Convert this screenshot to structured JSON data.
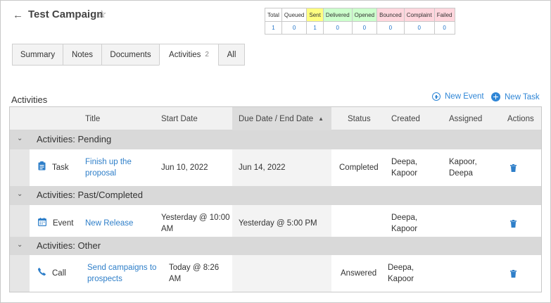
{
  "header": {
    "back_icon": "arrow-left-icon",
    "title": "Test Campaign",
    "star_icon": "star-outline-icon"
  },
  "stats": {
    "columns": [
      {
        "label": "Total",
        "value": "1",
        "color": "#ffffff"
      },
      {
        "label": "Queued",
        "value": "0",
        "color": "#ffffff"
      },
      {
        "label": "Sent",
        "value": "1",
        "color": "#ffff80"
      },
      {
        "label": "Delivered",
        "value": "0",
        "color": "#ccffcc"
      },
      {
        "label": "Opened",
        "value": "0",
        "color": "#ccffcc"
      },
      {
        "label": "Bounced",
        "value": "0",
        "color": "#ffd6dd"
      },
      {
        "label": "Complaint",
        "value": "0",
        "color": "#ffd6dd"
      },
      {
        "label": "Failed",
        "value": "0",
        "color": "#ffd6dd"
      }
    ]
  },
  "tabs": [
    {
      "label": "Summary",
      "count": ""
    },
    {
      "label": "Notes",
      "count": ""
    },
    {
      "label": "Documents",
      "count": ""
    },
    {
      "label": "Activities",
      "count": "2"
    },
    {
      "label": "All",
      "count": ""
    }
  ],
  "activities": {
    "title": "Activities",
    "new_event_label": "New Event",
    "new_task_label": "New Task",
    "columns": {
      "title": "Title",
      "start_date": "Start Date",
      "due_date": "Due Date / End Date",
      "status": "Status",
      "created": "Created",
      "assigned": "Assigned",
      "actions": "Actions"
    },
    "groups": [
      {
        "label": "Activities: Pending",
        "row": {
          "type_icon": "clipboard-icon",
          "type": "Task",
          "title_line1": "Finish up the",
          "title_line2": "proposal",
          "start_line1": "Jun 10, 2022",
          "start_line2": "",
          "due": "Jun 14, 2022",
          "status": "Completed",
          "created_line1": "Deepa,",
          "created_line2": "Kapoor",
          "assigned_line1": "Kapoor,",
          "assigned_line2": "Deepa"
        }
      },
      {
        "label": "Activities: Past/Completed",
        "row": {
          "type_icon": "calendar-icon",
          "type": "Event",
          "title_line1": "New Release",
          "title_line2": "",
          "start_line1": "Yesterday @ 10:00",
          "start_line2": "AM",
          "due": "Yesterday @ 5:00 PM",
          "status": "",
          "created_line1": "Deepa,",
          "created_line2": "Kapoor",
          "assigned_line1": "",
          "assigned_line2": ""
        }
      },
      {
        "label": "Activities: Other",
        "row": {
          "type_icon": "phone-icon",
          "type": "Call",
          "title_line1": "Send campaigns to",
          "title_line2": "prospects",
          "start_line1": "Today @ 8:26",
          "start_line2": "AM",
          "due": "",
          "status": "Answered",
          "created_line1": "Deepa,",
          "created_line2": "Kapoor",
          "assigned_line1": "",
          "assigned_line2": ""
        }
      }
    ]
  }
}
